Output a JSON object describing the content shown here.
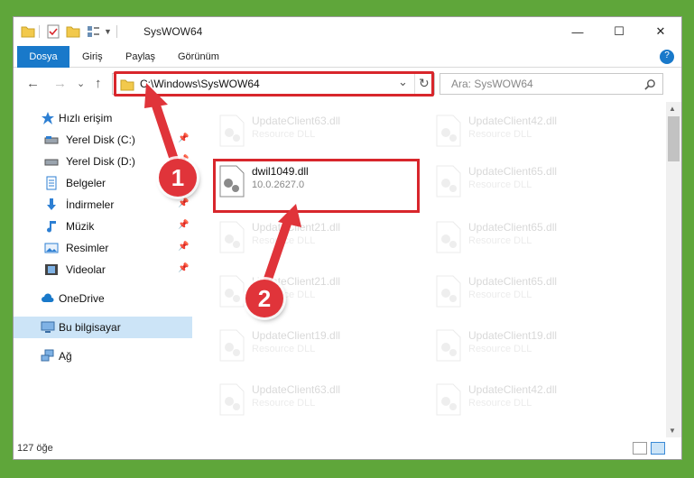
{
  "window": {
    "title": "SysWOW64",
    "minimize": "—",
    "maximize": "☐",
    "close": "✕"
  },
  "ribbon": {
    "tabs": [
      "Dosya",
      "Giriş",
      "Paylaş",
      "Görünüm"
    ],
    "help": "?"
  },
  "address": {
    "path": "C:\\Windows\\SysWOW64",
    "dropdown": "⌄",
    "refresh": "↻"
  },
  "search": {
    "placeholder": "Ara: SysWOW64"
  },
  "nav": {
    "back": "←",
    "forward": "→",
    "recent": "⌄",
    "up": "↑"
  },
  "sidebar": {
    "items": [
      {
        "label": "Hızlı erişim"
      },
      {
        "label": "Yerel Disk (C:)"
      },
      {
        "label": "Yerel Disk (D:)"
      },
      {
        "label": "Belgeler"
      },
      {
        "label": "İndirmeler"
      },
      {
        "label": "Müzik"
      },
      {
        "label": "Resimler"
      },
      {
        "label": "Videolar"
      },
      {
        "label": "OneDrive"
      },
      {
        "label": "Bu bilgisayar"
      },
      {
        "label": "Ağ"
      }
    ],
    "pin": "📌"
  },
  "files": [
    {
      "name": "UpdateClient63.dll",
      "desc": "Resource DLL"
    },
    {
      "name": "UpdateClient42.dll",
      "desc": "Resource DLL"
    },
    {
      "name": "dwil1049.dll",
      "desc": "10.0.2627.0"
    },
    {
      "name": "UpdateClient65.dll",
      "desc": "Resource DLL"
    },
    {
      "name": "UpdateClient21.dll",
      "desc": "Resource DLL"
    },
    {
      "name": "UpdateClient65.dll",
      "desc": "Resource DLL"
    },
    {
      "name": "UpdateClient21.dll",
      "desc": "Resource DLL"
    },
    {
      "name": "UpdateClient65.dll",
      "desc": "Resource DLL"
    },
    {
      "name": "UpdateClient19.dll",
      "desc": "Resource DLL"
    },
    {
      "name": "UpdateClient19.dll",
      "desc": "Resource DLL"
    },
    {
      "name": "UpdateClient63.dll",
      "desc": "Resource DLL"
    },
    {
      "name": "UpdateClient42.dll",
      "desc": "Resource DLL"
    }
  ],
  "status": {
    "count": "127 öğe"
  },
  "callouts": [
    "1",
    "2"
  ],
  "colors": {
    "accent": "#1979ca",
    "highlight": "#d8262c",
    "selection": "#cce4f7"
  }
}
